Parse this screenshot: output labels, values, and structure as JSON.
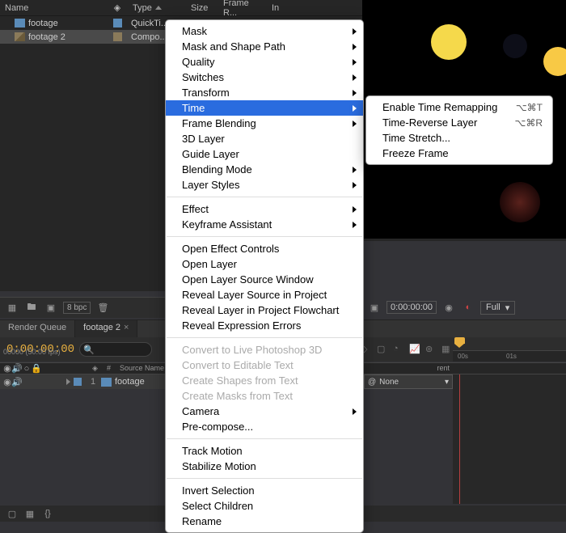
{
  "project": {
    "columns": {
      "name": "Name",
      "tag": "",
      "type": "Type",
      "size": "Size",
      "frameRate": "Frame R...",
      "in": "In"
    },
    "items": [
      {
        "name": "footage",
        "type": "QuickTi..."
      },
      {
        "name": "footage 2",
        "type": "Compo..."
      }
    ],
    "footer": {
      "bpc": "8 bpc"
    }
  },
  "previewToolbar": {
    "timecode": "0:00:00:00",
    "resolution": "Full"
  },
  "timeline": {
    "tabs": [
      {
        "label": "Render Queue"
      },
      {
        "label": "footage 2"
      }
    ],
    "timecode": "0:00:00:00",
    "frameInfo": "00000 (50.00 fps)",
    "searchPlaceholder": "",
    "colSourceName": "Source Name",
    "colParent": "rent",
    "rows": [
      {
        "num": "1",
        "name": "footage"
      }
    ],
    "parentSel": "None",
    "ruler": {
      "t1": "00s",
      "t2": "01s"
    }
  },
  "contextMenu": {
    "main": [
      {
        "label": "Mask",
        "sub": true
      },
      {
        "label": "Mask and Shape Path",
        "sub": true
      },
      {
        "label": "Quality",
        "sub": true
      },
      {
        "label": "Switches",
        "sub": true
      },
      {
        "label": "Transform",
        "sub": true
      },
      {
        "label": "Time",
        "sub": true,
        "sel": true
      },
      {
        "label": "Frame Blending",
        "sub": true
      },
      {
        "label": "3D Layer"
      },
      {
        "label": "Guide Layer"
      },
      {
        "label": "Blending Mode",
        "sub": true
      },
      {
        "label": "Layer Styles",
        "sub": true
      },
      {
        "sep": true
      },
      {
        "label": "Effect",
        "sub": true
      },
      {
        "label": "Keyframe Assistant",
        "sub": true
      },
      {
        "sep": true
      },
      {
        "label": "Open Effect Controls"
      },
      {
        "label": "Open Layer"
      },
      {
        "label": "Open Layer Source Window"
      },
      {
        "label": "Reveal Layer Source in Project"
      },
      {
        "label": "Reveal Layer in Project Flowchart"
      },
      {
        "label": "Reveal Expression Errors"
      },
      {
        "sep": true
      },
      {
        "label": "Convert to Live Photoshop 3D",
        "dis": true
      },
      {
        "label": "Convert to Editable Text",
        "dis": true
      },
      {
        "label": "Create Shapes from Text",
        "dis": true
      },
      {
        "label": "Create Masks from Text",
        "dis": true
      },
      {
        "label": "Camera",
        "sub": true
      },
      {
        "label": "Pre-compose..."
      },
      {
        "sep": true
      },
      {
        "label": "Track Motion"
      },
      {
        "label": "Stabilize Motion"
      },
      {
        "sep": true
      },
      {
        "label": "Invert Selection"
      },
      {
        "label": "Select Children"
      },
      {
        "label": "Rename"
      }
    ],
    "sub": [
      {
        "label": "Enable Time Remapping",
        "shortcut": "⌥⌘T"
      },
      {
        "label": "Time-Reverse Layer",
        "shortcut": "⌥⌘R"
      },
      {
        "label": "Time Stretch..."
      },
      {
        "label": "Freeze Frame"
      }
    ]
  }
}
